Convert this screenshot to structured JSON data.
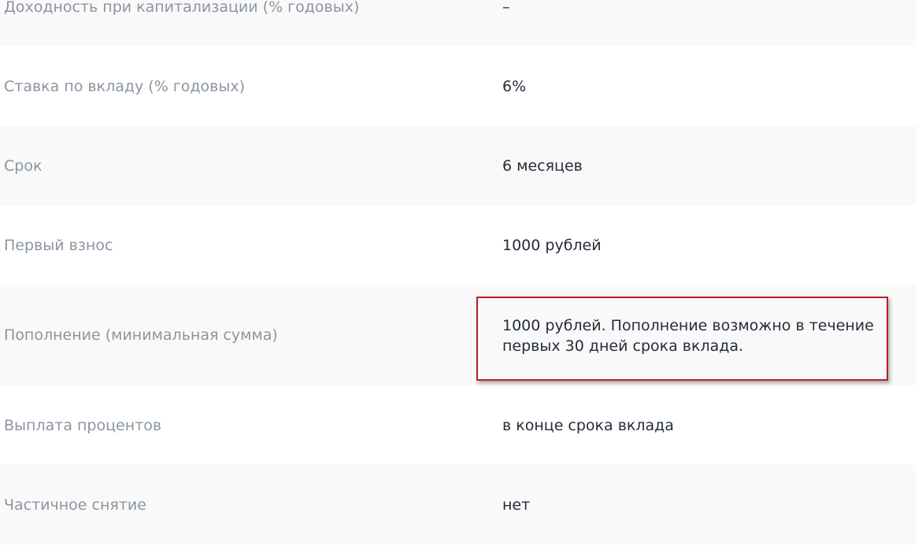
{
  "rows": [
    {
      "label": "Доходность при капитализации (% годовых)",
      "value": "–"
    },
    {
      "label": "Ставка по вкладу (% годовых)",
      "value": "6%"
    },
    {
      "label": "Срок",
      "value": "6 месяцев"
    },
    {
      "label": "Первый взнос",
      "value": "1000 рублей"
    },
    {
      "label": "Пополнение (минимальная сумма)",
      "value": "1000 рублей. Пополнение возможно в течение первых 30 дней срока вклада."
    },
    {
      "label": "Выплата процентов",
      "value": "в конце срока вклада"
    },
    {
      "label": "Частичное снятие",
      "value": "нет"
    }
  ],
  "colors": {
    "label_text": "#8b95a1",
    "value_text": "#242d3b",
    "row_alt_bg": "#f9f9f9",
    "highlight_border": "#b8202a"
  }
}
